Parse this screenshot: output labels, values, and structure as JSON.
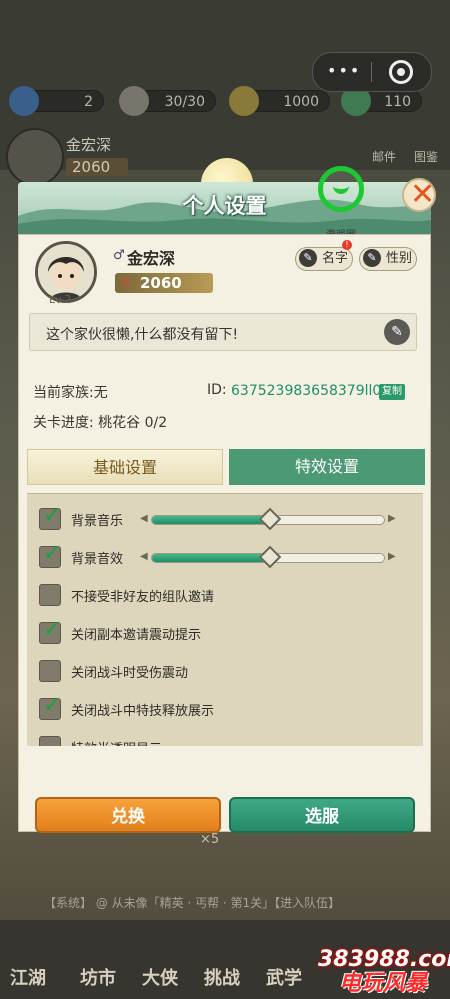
{
  "top": {
    "resources": [
      {
        "icon": "jade-icon",
        "value": "2"
      },
      {
        "icon": "stamina-icon",
        "value": "30/30"
      },
      {
        "icon": "coin-icon",
        "value": "1000"
      },
      {
        "icon": "green-gem-icon",
        "value": "110"
      }
    ],
    "player_name": "金宏深",
    "player_power": "2060",
    "tabs": [
      "邮件",
      "图鉴"
    ]
  },
  "dialog": {
    "title": "个人设置",
    "game_circle_label": "游戏圈",
    "profile": {
      "name": "金宏深",
      "level": "Lv.2",
      "power": "2060",
      "name_btn": "名字",
      "gender_btn": "性别"
    },
    "signature": "这个家伙很懒,什么都没有留下!",
    "family_label": "当前家族:无",
    "id_label": "ID:",
    "id_value": "637523983658379ll04",
    "copy_label": "复制",
    "stage_progress": "关卡进度: 桃花谷 0/2",
    "tabs": {
      "basic": "基础设置",
      "effects": "特效设置"
    },
    "options": [
      {
        "label": "背景音乐",
        "checked": true,
        "slider": 0.5
      },
      {
        "label": "背景音效",
        "checked": true,
        "slider": 0.5
      },
      {
        "label": "不接受非好友的组队邀请",
        "checked": false
      },
      {
        "label": "关闭副本邀请震动提示",
        "checked": true
      },
      {
        "label": "关闭战斗时受伤震动",
        "checked": false
      },
      {
        "label": "关闭战斗中特技释放展示",
        "checked": true
      },
      {
        "label": "特效半透明显示",
        "checked": false
      }
    ],
    "buttons": {
      "exchange": "兑换",
      "outfit": "选服"
    }
  },
  "bottom": {
    "chat_text": "【系统】 @ 从未像「精英 · 丐帮 · 第1关」【进入队伍】",
    "reward_count": "×5",
    "nav": [
      "江湖",
      "坊市",
      "大侠",
      "挑战",
      "武学"
    ]
  },
  "watermark": {
    "number": "383988.com",
    "text": "电玩风暴"
  },
  "colors": {
    "accent_green": "#1ec832",
    "teal": "#4c9a74",
    "orange": "#f09028"
  }
}
